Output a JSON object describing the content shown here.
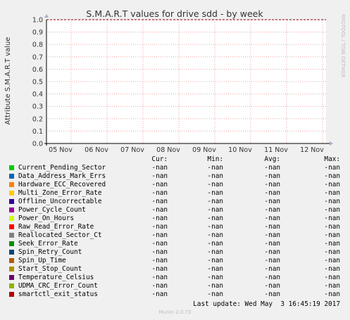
{
  "chart_data": {
    "type": "line",
    "title": "S.M.A.R.T values for drive sdd - by week",
    "ylabel": "Attribute S.M.A.R.T value",
    "watermark": "RRDTOOL / TOBI OETIKER",
    "ylim": [
      0,
      1.0
    ],
    "y_ticks": [
      "0.0",
      "0.1",
      "0.2",
      "0.3",
      "0.4",
      "0.5",
      "0.6",
      "0.7",
      "0.8",
      "0.9",
      "1.0"
    ],
    "x_ticks": [
      "05 Nov",
      "06 Nov",
      "07 Nov",
      "08 Nov",
      "09 Nov",
      "10 Nov",
      "11 Nov",
      "12 Nov"
    ],
    "threshold_line": 1.0,
    "threshold_color": "#8b0000",
    "grid": true
  },
  "legend": {
    "headers": [
      "Cur:",
      "Min:",
      "Avg:",
      "Max:"
    ],
    "items": [
      {
        "name": "Current_Pending_Sector",
        "color": "#00cc00",
        "cur": "-nan",
        "min": "-nan",
        "avg": "-nan",
        "max": "-nan"
      },
      {
        "name": "Data_Address_Mark_Errs",
        "color": "#0066b3",
        "cur": "-nan",
        "min": "-nan",
        "avg": "-nan",
        "max": "-nan"
      },
      {
        "name": "Hardware_ECC_Recovered",
        "color": "#ff8000",
        "cur": "-nan",
        "min": "-nan",
        "avg": "-nan",
        "max": "-nan"
      },
      {
        "name": "Multi_Zone_Error_Rate",
        "color": "#ffcc00",
        "cur": "-nan",
        "min": "-nan",
        "avg": "-nan",
        "max": "-nan"
      },
      {
        "name": "Offline_Uncorrectable",
        "color": "#330099",
        "cur": "-nan",
        "min": "-nan",
        "avg": "-nan",
        "max": "-nan"
      },
      {
        "name": "Power_Cycle_Count",
        "color": "#990099",
        "cur": "-nan",
        "min": "-nan",
        "avg": "-nan",
        "max": "-nan"
      },
      {
        "name": "Power_On_Hours",
        "color": "#ccff00",
        "cur": "-nan",
        "min": "-nan",
        "avg": "-nan",
        "max": "-nan"
      },
      {
        "name": "Raw_Read_Error_Rate",
        "color": "#ff0000",
        "cur": "-nan",
        "min": "-nan",
        "avg": "-nan",
        "max": "-nan"
      },
      {
        "name": "Reallocated_Sector_Ct",
        "color": "#808080",
        "cur": "-nan",
        "min": "-nan",
        "avg": "-nan",
        "max": "-nan"
      },
      {
        "name": "Seek_Error_Rate",
        "color": "#008f00",
        "cur": "-nan",
        "min": "-nan",
        "avg": "-nan",
        "max": "-nan"
      },
      {
        "name": "Spin_Retry_Count",
        "color": "#00487d",
        "cur": "-nan",
        "min": "-nan",
        "avg": "-nan",
        "max": "-nan"
      },
      {
        "name": "Spin_Up_Time",
        "color": "#b35a00",
        "cur": "-nan",
        "min": "-nan",
        "avg": "-nan",
        "max": "-nan"
      },
      {
        "name": "Start_Stop_Count",
        "color": "#b38f00",
        "cur": "-nan",
        "min": "-nan",
        "avg": "-nan",
        "max": "-nan"
      },
      {
        "name": "Temperature_Celsius",
        "color": "#6b006b",
        "cur": "-nan",
        "min": "-nan",
        "avg": "-nan",
        "max": "-nan"
      },
      {
        "name": "UDMA_CRC_Error_Count",
        "color": "#8fb300",
        "cur": "-nan",
        "min": "-nan",
        "avg": "-nan",
        "max": "-nan"
      },
      {
        "name": "smartctl_exit_status",
        "color": "#b30000",
        "cur": "-nan",
        "min": "-nan",
        "avg": "-nan",
        "max": "-nan"
      }
    ]
  },
  "footer": {
    "last_update": "Last update: Wed May  3 16:45:19 2017",
    "version": "Munin 2.0.73"
  }
}
